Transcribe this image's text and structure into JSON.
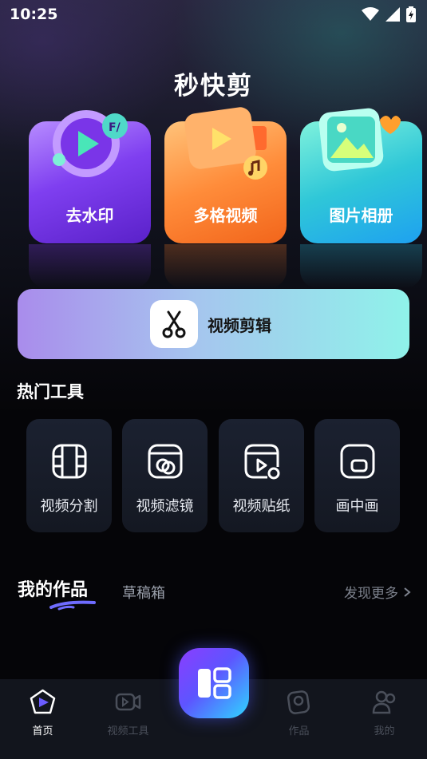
{
  "status_bar": {
    "time": "10:25"
  },
  "app": {
    "title": "秒快剪"
  },
  "features": [
    {
      "label": "去水印"
    },
    {
      "label": "多格视频"
    },
    {
      "label": "图片相册"
    }
  ],
  "video_edit": {
    "label": "视频剪辑"
  },
  "hot_tools": {
    "title": "热门工具",
    "items": [
      {
        "label": "视频分割",
        "icon": "film-split-icon"
      },
      {
        "label": "视频滤镜",
        "icon": "filter-icon"
      },
      {
        "label": "视频贴纸",
        "icon": "sticker-icon"
      },
      {
        "label": "画中画",
        "icon": "picture-in-picture-icon"
      }
    ]
  },
  "works": {
    "tab_mine": "我的作品",
    "tab_drafts": "草稿箱",
    "discover_more": "发现更多"
  },
  "bottom_nav": {
    "items": [
      {
        "label": "首页",
        "active": true
      },
      {
        "label": "视频工具",
        "active": false
      },
      {
        "label": "作品",
        "active": false
      },
      {
        "label": "我的",
        "active": false
      }
    ]
  },
  "colors": {
    "card_purple": "#7f3ff0",
    "card_orange": "#ff8c3a",
    "card_cyan": "#2fc7d8",
    "accent_blue": "#5d55ff"
  }
}
